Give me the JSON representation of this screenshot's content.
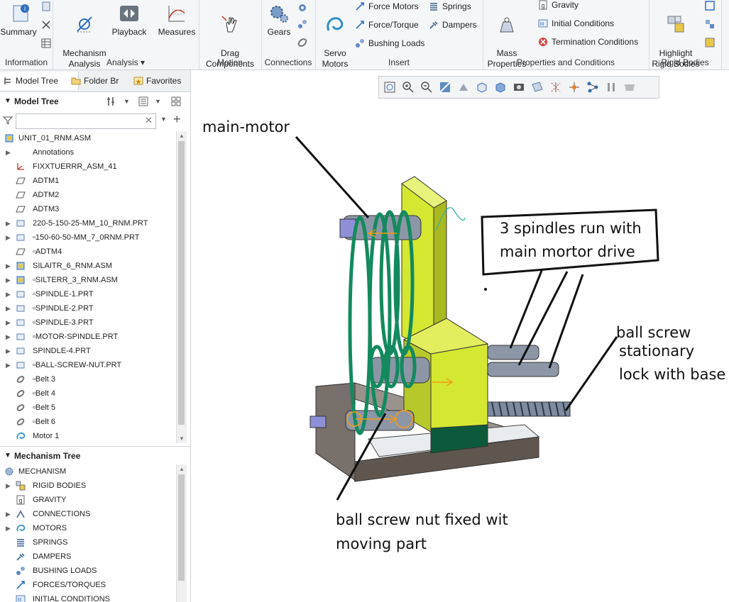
{
  "ribbon": {
    "groups": {
      "information": "Information",
      "analysis": "Analysis ▾",
      "motion": "Motion",
      "connections": "Connections",
      "insert": "Insert",
      "properties": "Properties and Conditions",
      "rigid": "Rigid Bodies"
    },
    "buttons": {
      "summary": "Summary",
      "mechanism_analysis": "Mechanism\nAnalysis",
      "playback": "Playback",
      "measures": "Measures",
      "drag_components": "Drag\nComponents",
      "gears": "Gears",
      "servo_motors": "Servo\nMotors",
      "force_motors": "Force Motors",
      "springs": "Springs",
      "force_torque": "Force/Torque",
      "dampers": "Dampers",
      "bushing_loads": "Bushing Loads",
      "mass_properties": "Mass\nProperties",
      "gravity": "Gravity",
      "initial_conditions": "Initial Conditions",
      "termination_conditions": "Termination Conditions",
      "highlight_rigid_bodies": "Highlight\nRigid Bodies"
    }
  },
  "left_panel": {
    "tabs": [
      "Model Tree",
      "Folder Br",
      "Favorites"
    ],
    "model_tree_title": "Model Tree",
    "search_placeholder": "",
    "model_items": [
      {
        "label": "UNIT_01_RNM.ASM",
        "expand": "",
        "icon": "assembly-icon",
        "root": true
      },
      {
        "label": "Annotations",
        "expand": "▶",
        "icon": "",
        "root": false
      },
      {
        "label": "FIXXTUERRR_ASM_41",
        "expand": "",
        "icon": "csys-icon",
        "root": false
      },
      {
        "label": "ADTM1",
        "expand": "",
        "icon": "datum-plane-icon",
        "root": false
      },
      {
        "label": "ADTM2",
        "expand": "",
        "icon": "datum-plane-icon",
        "root": false
      },
      {
        "label": "ADTM3",
        "expand": "",
        "icon": "datum-plane-icon",
        "root": false
      },
      {
        "label": "220-5-150-25-MM_10_RNM.PRT",
        "expand": "▶",
        "icon": "part-icon",
        "root": false
      },
      {
        "label": "▫150-60-50-MM_7_0RNM.PRT",
        "expand": "▶",
        "icon": "part-icon",
        "root": false
      },
      {
        "label": "▫ADTM4",
        "expand": "",
        "icon": "datum-plane-icon",
        "root": false
      },
      {
        "label": "SILAITR_6_RNM.ASM",
        "expand": "▶",
        "icon": "assembly-icon",
        "root": false
      },
      {
        "label": "▫SILTERR_3_RNM.ASM",
        "expand": "▶",
        "icon": "assembly-icon",
        "root": false
      },
      {
        "label": "▫SPINDLE-1.PRT",
        "expand": "▶",
        "icon": "part-icon",
        "root": false
      },
      {
        "label": "▫SPINDLE-2.PRT",
        "expand": "▶",
        "icon": "part-icon",
        "root": false
      },
      {
        "label": "▫SPINDLE-3.PRT",
        "expand": "▶",
        "icon": "part-icon",
        "root": false
      },
      {
        "label": "▫MOTOR-SPINDLE.PRT",
        "expand": "▶",
        "icon": "part-icon",
        "root": false
      },
      {
        "label": "SPINDLE-4.PRT",
        "expand": "▶",
        "icon": "part-icon",
        "root": false
      },
      {
        "label": "▫BALL-SCREW-NUT.PRT",
        "expand": "▶",
        "icon": "part-icon",
        "root": false
      },
      {
        "label": "▫Belt 3",
        "expand": "",
        "icon": "belt-icon",
        "root": false
      },
      {
        "label": "▫Belt 4",
        "expand": "",
        "icon": "belt-icon",
        "root": false
      },
      {
        "label": "▫Belt 5",
        "expand": "",
        "icon": "belt-icon",
        "root": false
      },
      {
        "label": "▫Belt 6",
        "expand": "",
        "icon": "belt-icon",
        "root": false
      },
      {
        "label": "Motor 1",
        "expand": "",
        "icon": "motor-icon",
        "root": false
      }
    ],
    "mechanism_tree_title": "Mechanism Tree",
    "mech_items": [
      {
        "label": "MECHANISM",
        "expand": "",
        "icon": "mechanism-icon",
        "root": true
      },
      {
        "label": "RIGID BODIES",
        "expand": "▶",
        "icon": "rigid-bodies-icon",
        "root": false
      },
      {
        "label": "GRAVITY",
        "expand": "",
        "icon": "gravity-icon",
        "root": false
      },
      {
        "label": "CONNECTIONS",
        "expand": "▶",
        "icon": "connections-icon",
        "root": false
      },
      {
        "label": "MOTORS",
        "expand": "▶",
        "icon": "motor-icon",
        "root": false
      },
      {
        "label": "SPRINGS",
        "expand": "",
        "icon": "spring-icon",
        "root": false
      },
      {
        "label": "DAMPERS",
        "expand": "",
        "icon": "damper-icon",
        "root": false
      },
      {
        "label": "BUSHING LOADS",
        "expand": "",
        "icon": "bushing-icon",
        "root": false
      },
      {
        "label": "FORCES/TORQUES",
        "expand": "",
        "icon": "force-icon",
        "root": false
      },
      {
        "label": "INITIAL CONDITIONS",
        "expand": "",
        "icon": "initial-conditions-icon",
        "root": false
      }
    ]
  },
  "viewport": {
    "annotations": {
      "main_motor": "main-motor",
      "spindles_line1": "3 spindles run with",
      "spindles_line2": "main mortor drive",
      "ball_screw_1": "ball screw",
      "ball_screw_2": "stationary",
      "ball_screw_3": "lock with base",
      "nut_line1": "ball screw nut  fixed wit",
      "nut_line2": "moving part"
    }
  },
  "colors": {
    "ribbon_bg": "#f5f6f7",
    "part_yellow": "#d4e832",
    "belt_green": "#138a5e",
    "base_brown": "#6e655f",
    "spindle_gray": "#8d96a6"
  }
}
